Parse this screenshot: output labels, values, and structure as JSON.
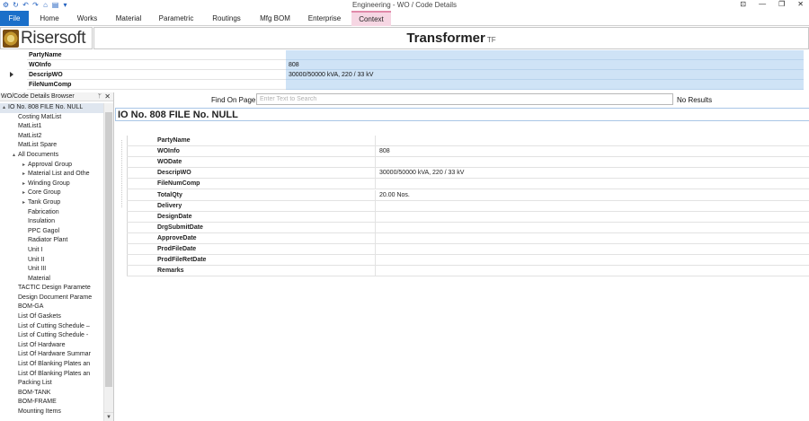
{
  "window": {
    "title": "Engineering - WO / Code Details"
  },
  "ribbon": {
    "tabs": [
      {
        "label": "File"
      },
      {
        "label": "Home"
      },
      {
        "label": "Works"
      },
      {
        "label": "Material"
      },
      {
        "label": "Parametric"
      },
      {
        "label": "Routings"
      },
      {
        "label": "Mfg BOM"
      },
      {
        "label": "Enterprise"
      },
      {
        "label": "Context"
      }
    ]
  },
  "brand": {
    "name": "Risersoft"
  },
  "header": {
    "title": "Transformer",
    "suffix": "TF"
  },
  "top_grid": {
    "rows": [
      {
        "label": "PartyName",
        "value": ""
      },
      {
        "label": "WOInfo",
        "value": "808"
      },
      {
        "label": "DescripWO",
        "value": "30000/50000 kVA, 220 / 33 kV"
      },
      {
        "label": "FileNumComp",
        "value": ""
      }
    ]
  },
  "browser": {
    "title": "WO/Code Details Browser",
    "pin": "ᛘ",
    "close": "✕",
    "items": [
      {
        "label": "IO No. 808 FILE No. NULL",
        "indent": 0,
        "exp": "▴",
        "selected": true
      },
      {
        "label": "Costing MatList",
        "indent": 1,
        "exp": ""
      },
      {
        "label": "MatList1",
        "indent": 1,
        "exp": ""
      },
      {
        "label": "MatList2",
        "indent": 1,
        "exp": ""
      },
      {
        "label": "MatList Spare",
        "indent": 1,
        "exp": ""
      },
      {
        "label": "All Documents",
        "indent": 1,
        "exp": "▴"
      },
      {
        "label": "Approval Group",
        "indent": 2,
        "exp": "▸"
      },
      {
        "label": "Material List and Othe",
        "indent": 2,
        "exp": "▸"
      },
      {
        "label": "Winding Group",
        "indent": 2,
        "exp": "▸"
      },
      {
        "label": "Core Group",
        "indent": 2,
        "exp": "▸"
      },
      {
        "label": "Tank Group",
        "indent": 2,
        "exp": "▸"
      },
      {
        "label": "Fabrication",
        "indent": 2,
        "exp": ""
      },
      {
        "label": "Insulation",
        "indent": 2,
        "exp": ""
      },
      {
        "label": "PPC Gagol",
        "indent": 2,
        "exp": ""
      },
      {
        "label": "Radiator Plant",
        "indent": 2,
        "exp": ""
      },
      {
        "label": "Unit I",
        "indent": 2,
        "exp": ""
      },
      {
        "label": "Unit II",
        "indent": 2,
        "exp": ""
      },
      {
        "label": "Unit III",
        "indent": 2,
        "exp": ""
      },
      {
        "label": "Material",
        "indent": 2,
        "exp": ""
      },
      {
        "label": "TACTIC Design Paramete",
        "indent": 1,
        "exp": ""
      },
      {
        "label": "Design Document Parame",
        "indent": 1,
        "exp": ""
      },
      {
        "label": "BOM-GA",
        "indent": 1,
        "exp": ""
      },
      {
        "label": "List Of Gaskets",
        "indent": 1,
        "exp": ""
      },
      {
        "label": "List of Cutting Schedule –",
        "indent": 1,
        "exp": ""
      },
      {
        "label": "List of Cutting Schedule -",
        "indent": 1,
        "exp": ""
      },
      {
        "label": "List Of Hardware",
        "indent": 1,
        "exp": ""
      },
      {
        "label": "List Of Hardware Summar",
        "indent": 1,
        "exp": ""
      },
      {
        "label": "List Of Blanking Plates an",
        "indent": 1,
        "exp": ""
      },
      {
        "label": "List Of Blanking Plates an",
        "indent": 1,
        "exp": ""
      },
      {
        "label": "Packing List",
        "indent": 1,
        "exp": ""
      },
      {
        "label": "BOM-TANK",
        "indent": 1,
        "exp": ""
      },
      {
        "label": "BOM-FRAME",
        "indent": 1,
        "exp": ""
      },
      {
        "label": "Mounting Items",
        "indent": 1,
        "exp": ""
      }
    ]
  },
  "find": {
    "label": "Find On Page",
    "placeholder": "Enter Text to Search",
    "result": "No Results"
  },
  "record": {
    "title": "IO No. 808 FILE No. NULL",
    "fields": [
      {
        "label": "PartyName",
        "value": ""
      },
      {
        "label": "WOInfo",
        "value": "808"
      },
      {
        "label": "WODate",
        "value": ""
      },
      {
        "label": "DescripWO",
        "value": "30000/50000 kVA, 220 / 33 kV"
      },
      {
        "label": "FileNumComp",
        "value": ""
      },
      {
        "label": "TotalQty",
        "value": "20.00 Nos."
      },
      {
        "label": "Delivery",
        "value": ""
      },
      {
        "label": "DesignDate",
        "value": ""
      },
      {
        "label": "DrgSubmitDate",
        "value": ""
      },
      {
        "label": "ApproveDate",
        "value": ""
      },
      {
        "label": "ProdFileDate",
        "value": ""
      },
      {
        "label": "ProdFileRetDate",
        "value": ""
      },
      {
        "label": "Remarks",
        "value": ""
      }
    ]
  },
  "colors": {
    "file_tab": "#1a6fc9",
    "context_tab": "#f6d6e3",
    "value_highlight": "#cfe3f6"
  }
}
